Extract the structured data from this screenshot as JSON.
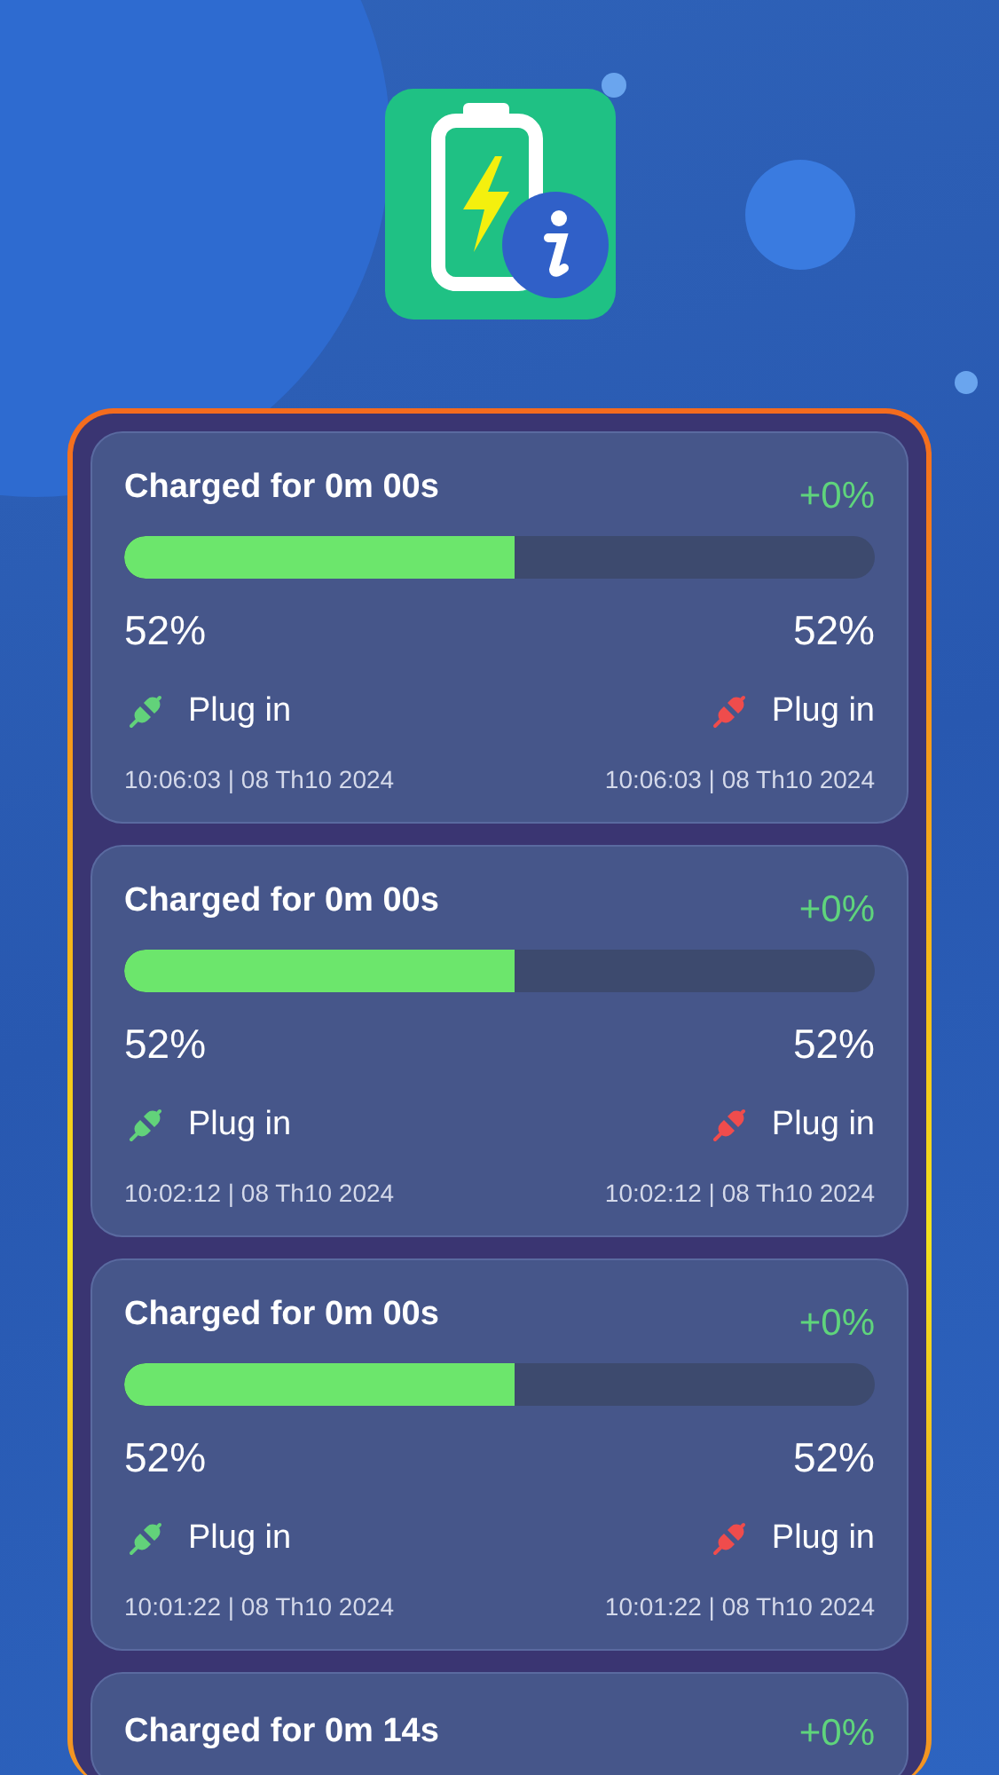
{
  "sessions": [
    {
      "kind": "full",
      "title": "Charged for 0m 00s",
      "gain": "+0%",
      "level": 0.52,
      "start_percent": "52%",
      "end_percent": "52%",
      "start_label": "Plug in",
      "end_label": "Plug in",
      "start_time": "10:06:03 | 08 Th10 2024",
      "end_time": "10:06:03 | 08 Th10 2024"
    },
    {
      "kind": "full",
      "title": "Charged for 0m 00s",
      "gain": "+0%",
      "level": 0.52,
      "start_percent": "52%",
      "end_percent": "52%",
      "start_label": "Plug in",
      "end_label": "Plug in",
      "start_time": "10:02:12 | 08 Th10 2024",
      "end_time": "10:02:12 | 08 Th10 2024"
    },
    {
      "kind": "full",
      "title": "Charged for 0m 00s",
      "gain": "+0%",
      "level": 0.52,
      "start_percent": "52%",
      "end_percent": "52%",
      "start_label": "Plug in",
      "end_label": "Plug in",
      "start_time": "10:01:22 | 08 Th10 2024",
      "end_time": "10:01:22 | 08 Th10 2024"
    },
    {
      "kind": "partial",
      "title": "Charged for 0m 14s",
      "gain": "+0%"
    }
  ]
}
